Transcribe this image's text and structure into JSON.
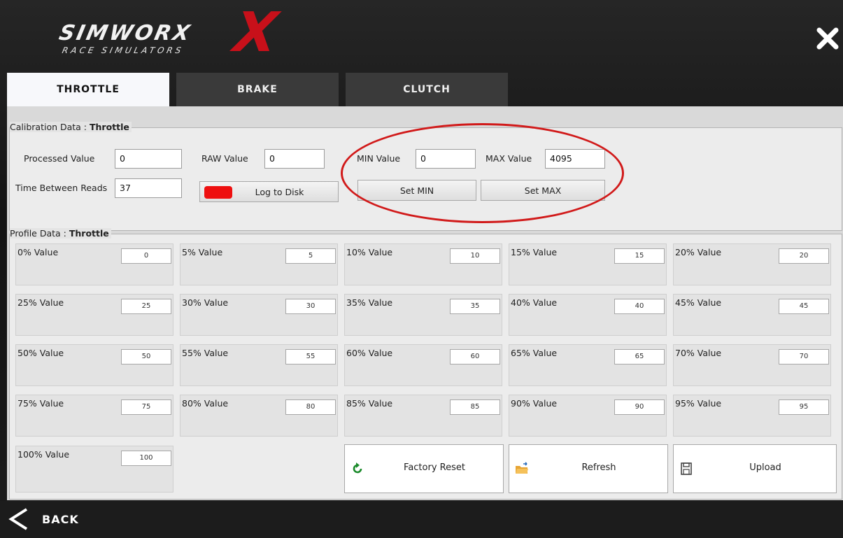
{
  "header": {
    "logo_main": "SIMWORX",
    "logo_sub": "RACE SIMULATORS"
  },
  "tabs": [
    {
      "label": "THROTTLE",
      "active": true
    },
    {
      "label": "BRAKE",
      "active": false
    },
    {
      "label": "CLUTCH",
      "active": false
    }
  ],
  "calibration": {
    "legend_prefix": "Calibration Data : ",
    "legend_name": "Throttle",
    "processed_label": "Processed Value",
    "processed_value": "0",
    "raw_label": "RAW Value",
    "raw_value": "0",
    "min_label": "MIN Value",
    "min_value": "0",
    "max_label": "MAX Value",
    "max_value": "4095",
    "time_label": "Time Between Reads",
    "time_value": "37",
    "log_label": "Log to Disk",
    "log_indicator_color": "#ee1010",
    "set_min_label": "Set MIN",
    "set_max_label": "Set MAX"
  },
  "profile": {
    "legend_prefix": "Profile Data : ",
    "legend_name": "Throttle",
    "cells": [
      {
        "label": "0% Value",
        "value": "0"
      },
      {
        "label": "5% Value",
        "value": "5"
      },
      {
        "label": "10% Value",
        "value": "10"
      },
      {
        "label": "15% Value",
        "value": "15"
      },
      {
        "label": "20% Value",
        "value": "20"
      },
      {
        "label": "25% Value",
        "value": "25"
      },
      {
        "label": "30% Value",
        "value": "30"
      },
      {
        "label": "35% Value",
        "value": "35"
      },
      {
        "label": "40% Value",
        "value": "40"
      },
      {
        "label": "45% Value",
        "value": "45"
      },
      {
        "label": "50% Value",
        "value": "50"
      },
      {
        "label": "55% Value",
        "value": "55"
      },
      {
        "label": "60% Value",
        "value": "60"
      },
      {
        "label": "65% Value",
        "value": "65"
      },
      {
        "label": "70% Value",
        "value": "70"
      },
      {
        "label": "75% Value",
        "value": "75"
      },
      {
        "label": "80% Value",
        "value": "80"
      },
      {
        "label": "85% Value",
        "value": "85"
      },
      {
        "label": "90% Value",
        "value": "90"
      },
      {
        "label": "95% Value",
        "value": "95"
      },
      {
        "label": "100% Value",
        "value": "100"
      }
    ],
    "actions": [
      {
        "label": "Factory Reset",
        "icon": "reset-icon"
      },
      {
        "label": "Refresh",
        "icon": "folder-icon"
      },
      {
        "label": "Upload",
        "icon": "save-icon"
      }
    ]
  },
  "footer": {
    "back_label": "BACK"
  },
  "colors": {
    "accent_red": "#c8101a",
    "annotation_oval": "#d11a1a"
  }
}
